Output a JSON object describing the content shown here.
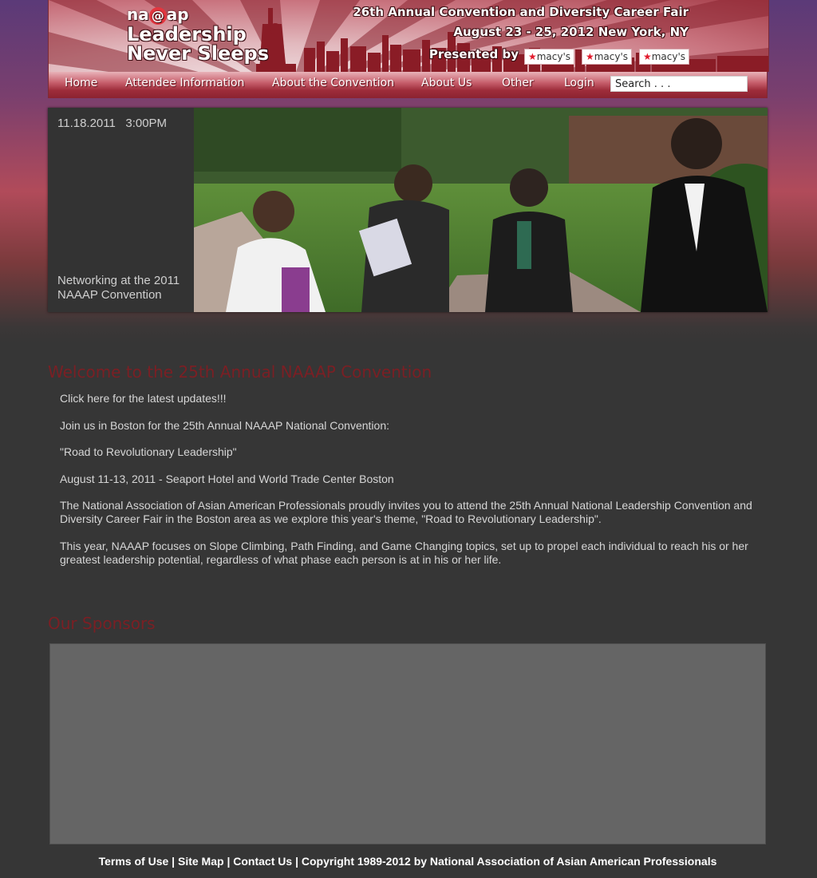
{
  "header": {
    "logo_text_left": "na",
    "logo_at": "@",
    "logo_text_right": "ap",
    "tagline_line1": "Leadership",
    "tagline_line2": "Never Sleeps",
    "convention_title": "26th Annual Convention and Diversity Career Fair",
    "convention_date": "August 23 - 25, 2012 New York, NY",
    "presented_by": "Presented by",
    "sponsor_logos": [
      "macy's",
      "macy's",
      "macy's"
    ]
  },
  "nav": {
    "items": [
      {
        "label": "Home"
      },
      {
        "label": "Attendee Information"
      },
      {
        "label": "About the Convention"
      },
      {
        "label": "About Us"
      },
      {
        "label": "Other"
      },
      {
        "label": "Login"
      }
    ],
    "search_placeholder": "Search . . ."
  },
  "feature": {
    "date": "11.18.2011   3:00PM",
    "caption": "Networking at the 2011 NAAAP Convention"
  },
  "welcome": {
    "heading": "Welcome to the 25th Annual NAAAP Convention",
    "link": "Click here for the latest updates!!!",
    "p1": "Join us in Boston for the 25th Annual NAAAP National Convention:",
    "p2": "\"Road to Revolutionary Leadership\"",
    "p3": "August 11-13, 2011 - Seaport Hotel and World Trade Center Boston",
    "p4": "The National Association of Asian American Professionals proudly invites you to attend the 25th Annual National Leadership Convention and Diversity Career Fair in the Boston area as we explore this year's theme, \"Road to Revolutionary Leadership\".",
    "p5": "This year, NAAAP focuses on Slope Climbing, Path Finding, and Game Changing topics, set up to propel each individual to reach his or her greatest leadership potential, regardless of what phase each person is at in his or her life."
  },
  "sponsors": {
    "heading": "Our Sponsors"
  },
  "footer": {
    "terms": "Terms of Use",
    "site_map": "Site Map",
    "contact": "Contact Us",
    "separator": "|",
    "copyright": "Copyright 1989-2012 by National Association of Asian American Professionals"
  },
  "colors": {
    "accent": "#8b2330",
    "heading": "#7b1f24",
    "background": "#363636"
  }
}
